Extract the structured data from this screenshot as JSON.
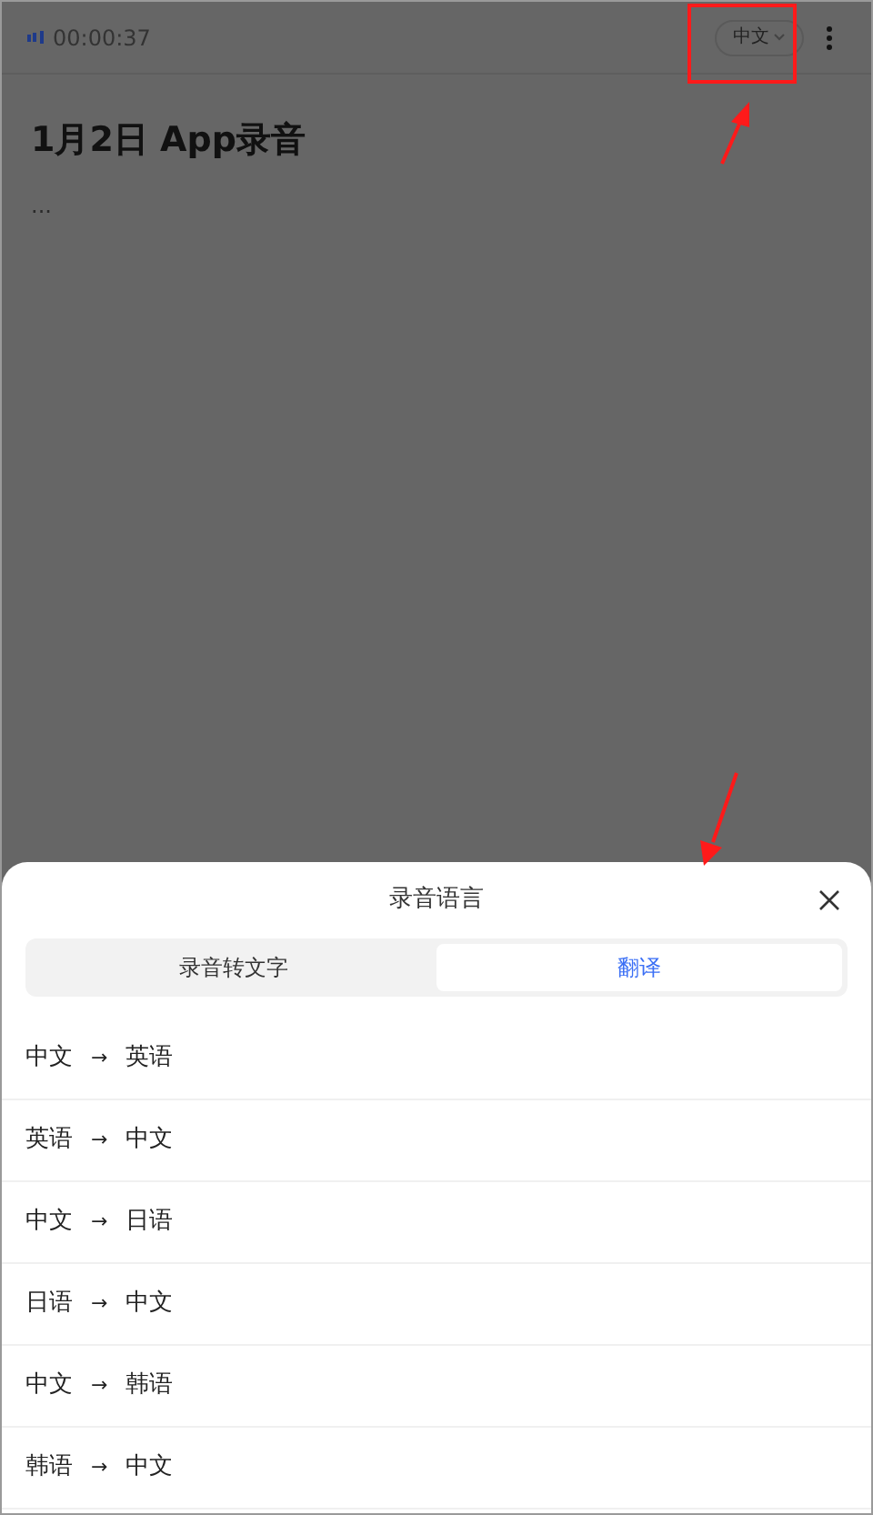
{
  "status": {
    "timer": "00:00:37",
    "language": "中文"
  },
  "note": {
    "title": "1月2日 App录音",
    "body": "..."
  },
  "sheet": {
    "title": "录音语言",
    "tabs": [
      {
        "label": "录音转文字",
        "selected": false
      },
      {
        "label": "翻译",
        "selected": true
      }
    ],
    "options": [
      {
        "from": "中文",
        "arrow": "→",
        "to": "英语"
      },
      {
        "from": "英语",
        "arrow": "→",
        "to": "中文"
      },
      {
        "from": "中文",
        "arrow": "→",
        "to": "日语"
      },
      {
        "from": "日语",
        "arrow": "→",
        "to": "中文"
      },
      {
        "from": "中文",
        "arrow": "→",
        "to": "韩语"
      },
      {
        "from": "韩语",
        "arrow": "→",
        "to": "中文"
      }
    ]
  }
}
